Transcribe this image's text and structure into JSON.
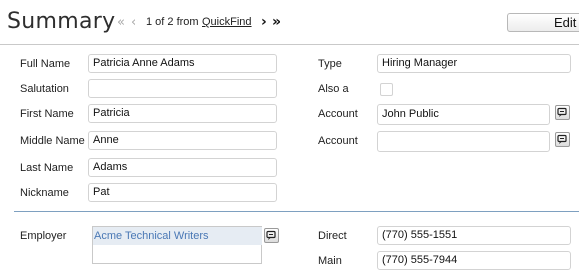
{
  "header": {
    "title": "Summary",
    "nav_first": "«",
    "nav_prev": "‹",
    "record_position": "1 of 2 from",
    "quickfind_link": "QuickFind",
    "nav_next": "›",
    "nav_last": "»",
    "edit_label": "Edit"
  },
  "left_fields": {
    "full_name": {
      "label": "Full Name",
      "value": "Patricia Anne Adams"
    },
    "salutation": {
      "label": "Salutation",
      "value": ""
    },
    "first_name": {
      "label": "First Name",
      "value": "Patricia"
    },
    "middle_name": {
      "label": "Middle Name",
      "value": "Anne"
    },
    "last_name": {
      "label": "Last Name",
      "value": "Adams"
    },
    "nickname": {
      "label": "Nickname",
      "value": "Pat"
    }
  },
  "right_fields": {
    "type": {
      "label": "Type",
      "value": "Hiring Manager"
    },
    "also_a": {
      "label": "Also a",
      "checked": false
    },
    "account1": {
      "label": "Account",
      "value": "John Public"
    },
    "account2": {
      "label": "Account",
      "value": ""
    }
  },
  "employer": {
    "label": "Employer",
    "items": [
      "Acme Technical Writers"
    ]
  },
  "phones": {
    "direct": {
      "label": "Direct",
      "value": "(770) 555-1551"
    },
    "main": {
      "label": "Main",
      "value": "(770) 555-7944"
    }
  },
  "colors": {
    "separator": "#7ea0c0",
    "link": "#4a78b5",
    "selected_bg": "#e6ecf3"
  },
  "icons": {
    "lookup": "lookup-icon",
    "checkbox": "checkbox-icon"
  }
}
